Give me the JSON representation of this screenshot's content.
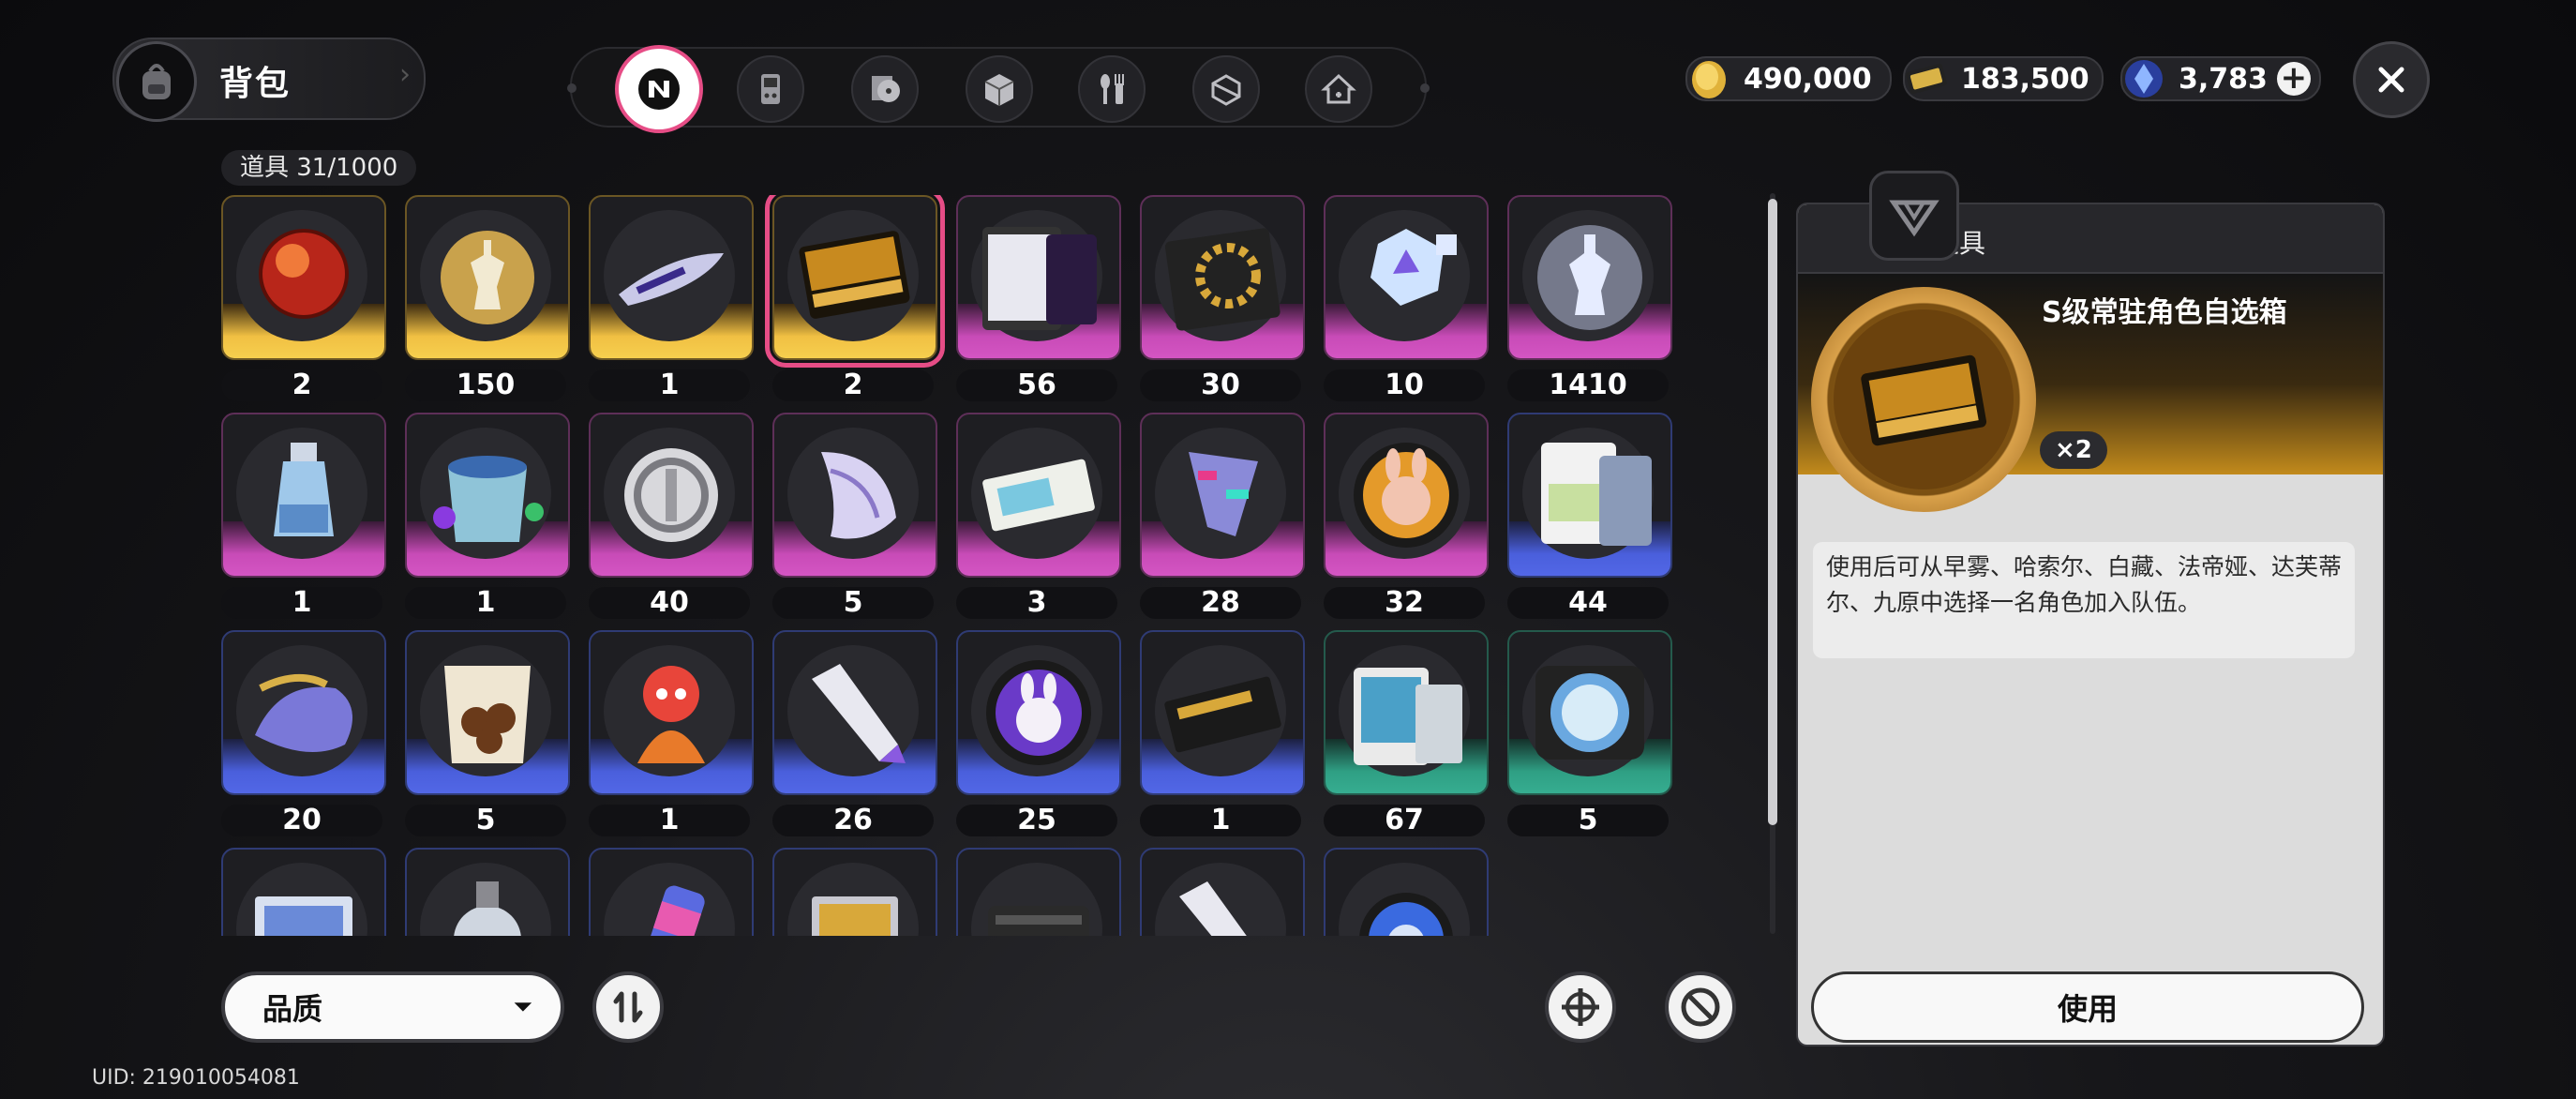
{
  "header": {
    "title": "背包",
    "tabs": [
      {
        "name": "tab-featured",
        "icon": "n-logo-icon",
        "active": true
      },
      {
        "name": "tab-device",
        "icon": "gameboy-icon"
      },
      {
        "name": "tab-disc",
        "icon": "disc-icon"
      },
      {
        "name": "tab-box",
        "icon": "cube-icon"
      },
      {
        "name": "tab-food",
        "icon": "fork-spoon-icon"
      },
      {
        "name": "tab-material",
        "icon": "box-open-icon"
      },
      {
        "name": "tab-home",
        "icon": "house-icon"
      }
    ],
    "currencies": [
      {
        "name": "coin-currency",
        "icon": "gold-coin-icon",
        "value": "490,000"
      },
      {
        "name": "ticket-currency",
        "icon": "ticket-icon",
        "value": "183,500"
      },
      {
        "name": "crystal-currency",
        "icon": "crystal-icon",
        "value": "3,783"
      }
    ]
  },
  "inventory": {
    "count_label": "道具 31/1000",
    "items": [
      {
        "qty": "2",
        "q": "gold",
        "icon": "red-orb-icon"
      },
      {
        "qty": "150",
        "q": "gold",
        "icon": "chess-king-icon"
      },
      {
        "qty": "1",
        "q": "gold",
        "icon": "shuttle-icon"
      },
      {
        "qty": "2",
        "q": "gold",
        "icon": "gold-card-icon",
        "selected": true
      },
      {
        "qty": "56",
        "q": "purple",
        "icon": "tablet-icon"
      },
      {
        "qty": "30",
        "q": "purple",
        "icon": "gear-box-icon"
      },
      {
        "qty": "10",
        "q": "purple",
        "icon": "crystal-cubes-icon"
      },
      {
        "qty": "1410",
        "q": "purple",
        "icon": "crystal-chess-icon"
      },
      {
        "qty": "1",
        "q": "purple",
        "icon": "bottle-icon"
      },
      {
        "qty": "1",
        "q": "purple",
        "icon": "paint-bucket-icon"
      },
      {
        "qty": "40",
        "q": "purple",
        "icon": "silver-coin-icon"
      },
      {
        "qty": "5",
        "q": "purple",
        "icon": "seashell-icon"
      },
      {
        "qty": "3",
        "q": "purple",
        "icon": "ticket-stub-icon"
      },
      {
        "qty": "28",
        "q": "purple",
        "icon": "glitch-shard-icon"
      },
      {
        "qty": "32",
        "q": "purple",
        "icon": "bunny-medal-icon"
      },
      {
        "qty": "44",
        "q": "blue",
        "icon": "cards-icon"
      },
      {
        "qty": "20",
        "q": "blue",
        "icon": "fish-icon"
      },
      {
        "qty": "5",
        "q": "blue",
        "icon": "snack-bag-icon"
      },
      {
        "qty": "1",
        "q": "blue",
        "icon": "plush-icon"
      },
      {
        "qty": "26",
        "q": "blue",
        "icon": "tube-icon"
      },
      {
        "qty": "25",
        "q": "blue",
        "icon": "bunny-badge-icon"
      },
      {
        "qty": "1",
        "q": "blue",
        "icon": "black-ticket-icon"
      },
      {
        "qty": "67",
        "q": "green",
        "icon": "tablet-cards-icon"
      },
      {
        "qty": "5",
        "q": "green",
        "icon": "record-player-icon"
      },
      {
        "qty": "",
        "q": "blue",
        "icon": "photo-frame-icon"
      },
      {
        "qty": "",
        "q": "blue",
        "icon": "watch-icon"
      },
      {
        "qty": "",
        "q": "blue",
        "icon": "can-icon"
      },
      {
        "qty": "",
        "q": "blue",
        "icon": "laptop-icon"
      },
      {
        "qty": "",
        "q": "blue",
        "icon": "case-icon"
      },
      {
        "qty": "",
        "q": "blue",
        "icon": "tube-icon"
      },
      {
        "qty": "",
        "q": "blue",
        "icon": "blue-badge-icon"
      }
    ]
  },
  "controls": {
    "sort_label": "品质",
    "sort_arrow": "⏷"
  },
  "details": {
    "category": "道具",
    "name": "S级常驻角色自选箱",
    "qty": "×2",
    "description": "使用后可从早雾、哈索尔、白藏、法帝娅、达芙蒂尔、九原中选择一名角色加入队伍。",
    "use_label": "使用"
  },
  "uid": "UID: 219010054081",
  "colors": {
    "accent_pink": "#e64d86",
    "gold": "#f1c043",
    "purple": "#c84bb7",
    "blue": "#4a5fdc",
    "green": "#2f9f84"
  }
}
